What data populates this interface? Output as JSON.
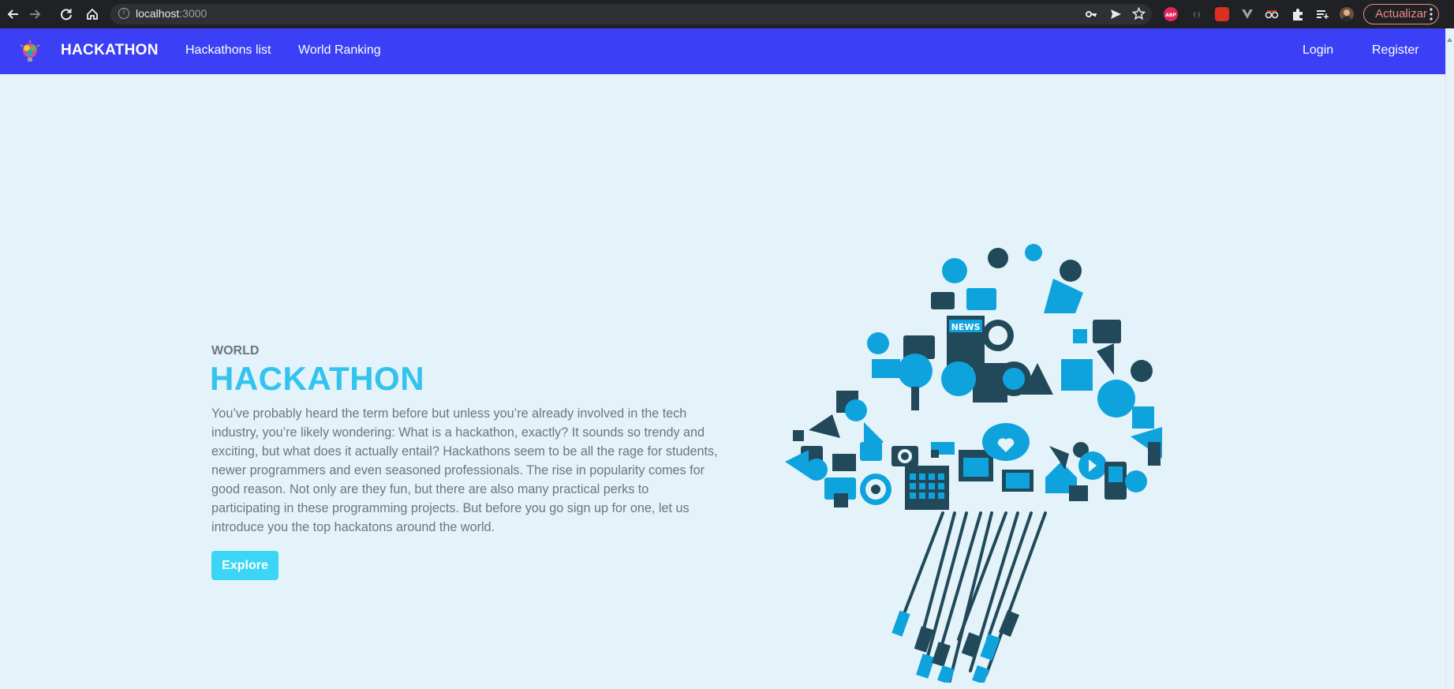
{
  "browser": {
    "url_host": "localhost",
    "url_port": ":3000",
    "update_label": "Actualizar"
  },
  "navbar": {
    "brand": "HACKATHON",
    "links": [
      "Hackathons list",
      "World Ranking"
    ],
    "login": "Login",
    "register": "Register"
  },
  "hero": {
    "eyebrow": "WORLD",
    "title": "HACKATHON",
    "text": "You’ve probably heard the term before but unless you’re already involved in the tech industry, you’re likely wondering: What is a hackathon, exactly? It sounds so trendy and exciting, but what does it actually entail? Hackathons seem to be all the rage for students, newer programmers and even seasoned professionals. The rise in popularity comes for good reason. Not only are they fun, but there are also many practical perks to participating in these programming projects. But before you go sign up for one, let us introduce you the top hackatons around the world.",
    "button": "Explore",
    "illustration_label": "NEWS"
  },
  "colors": {
    "navbar": "#3b3ff5",
    "accent": "#33c3ef",
    "button": "#3bd6f5",
    "background": "#e4f3f9",
    "icon_dark": "#21495a",
    "icon_blue": "#0fa3dd"
  },
  "icons": [
    "back-icon",
    "forward-icon",
    "reload-icon",
    "home-icon",
    "info-icon",
    "key-icon",
    "send-icon",
    "star-icon",
    "adblock-icon",
    "extension-icons",
    "puzzle-icon",
    "reading-list-icon",
    "profile-avatar",
    "menu-dots-icon",
    "hackathon-logo",
    "cloud-tech-illustration"
  ]
}
